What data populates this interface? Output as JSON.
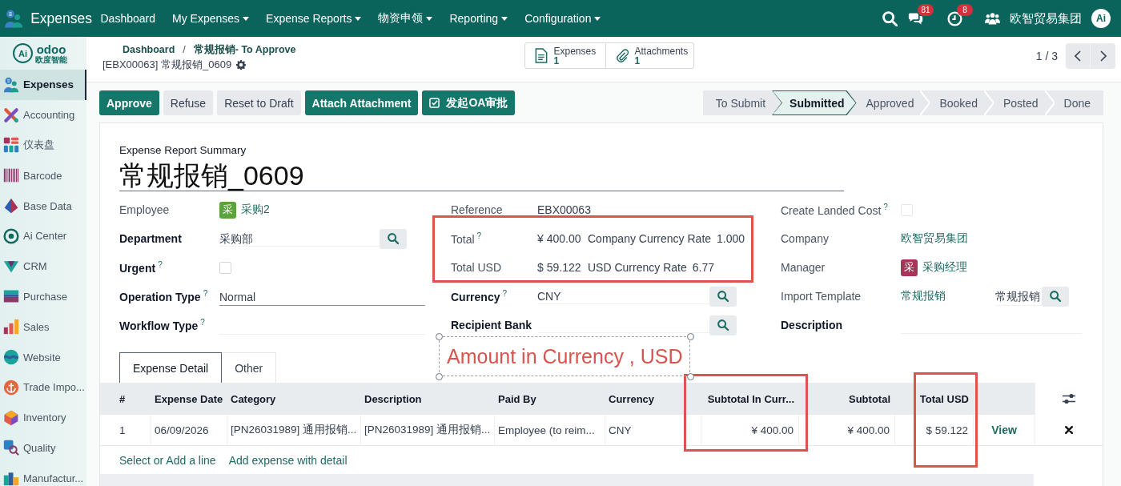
{
  "navbar": {
    "app_name": "Expenses",
    "menus": [
      {
        "label": "Dashboard",
        "dropdown": false
      },
      {
        "label": "My Expenses",
        "dropdown": true
      },
      {
        "label": "Expense Reports",
        "dropdown": true
      },
      {
        "label": "物资申领",
        "dropdown": true
      },
      {
        "label": "Reporting",
        "dropdown": true
      },
      {
        "label": "Configuration",
        "dropdown": true
      }
    ],
    "message_count": "81",
    "activity_count": "8",
    "company": "欧智贸易集团",
    "user_avatar": "Ai"
  },
  "sidebar": {
    "brand": {
      "mark": "Ai",
      "name": "odoo",
      "subtitle": "欧度智能"
    },
    "items": [
      {
        "label": "Expenses",
        "selected": true
      },
      {
        "label": "Accounting",
        "selected": false
      },
      {
        "label": "仪表盘",
        "selected": false
      },
      {
        "label": "Barcode",
        "selected": false
      },
      {
        "label": "Base Data",
        "selected": false
      },
      {
        "label": "Ai Center",
        "selected": false
      },
      {
        "label": "CRM",
        "selected": false
      },
      {
        "label": "Purchase",
        "selected": false
      },
      {
        "label": "Sales",
        "selected": false
      },
      {
        "label": "Website",
        "selected": false
      },
      {
        "label": "Trade Impo...",
        "selected": false
      },
      {
        "label": "Inventory",
        "selected": false
      },
      {
        "label": "Quality",
        "selected": false
      },
      {
        "label": "Manufactur...",
        "selected": false
      }
    ]
  },
  "control_panel": {
    "breadcrumbs": [
      "Dashboard",
      "常规报销- To Approve"
    ],
    "breadcrumb_separator": "/",
    "record_title": "[EBX00063] 常规报销_0609",
    "smart_buttons": [
      {
        "label": "Expenses",
        "count": "1"
      },
      {
        "label": "Attachments",
        "count": "1"
      }
    ],
    "pager": "1 / 3"
  },
  "actions": [
    {
      "label": "Approve",
      "kind": "primary",
      "checkbox_icon": false
    },
    {
      "label": "Refuse",
      "kind": "secondary",
      "checkbox_icon": false
    },
    {
      "label": "Reset to Draft",
      "kind": "secondary",
      "checkbox_icon": false
    },
    {
      "label": "Attach Attachment",
      "kind": "primary",
      "checkbox_icon": false
    },
    {
      "label": "发起OA审批",
      "kind": "primary",
      "checkbox_icon": true
    }
  ],
  "status_stages": [
    {
      "label": "To Submit",
      "selected": false
    },
    {
      "label": "Submitted",
      "selected": true
    },
    {
      "label": "Approved",
      "selected": false
    },
    {
      "label": "Booked",
      "selected": false
    },
    {
      "label": "Posted",
      "selected": false
    },
    {
      "label": "Done",
      "selected": false
    }
  ],
  "form": {
    "title_label": "Expense Report Summary",
    "title": "常规报销_0609",
    "columns": [
      {
        "fields": [
          {
            "label": "Employee",
            "readonly": true,
            "kind": "avatar",
            "avatar": {
              "letter": "采",
              "color": "#5ba33b"
            },
            "value": "采购2"
          },
          {
            "label": "Department",
            "readonly": false,
            "kind": "many2one",
            "value": "采购部"
          },
          {
            "label": "Urgent",
            "help": "?",
            "readonly": false,
            "kind": "checkbox",
            "checked": false
          },
          {
            "label": "Operation Type",
            "help": "?",
            "readonly": false,
            "kind": "select",
            "value": "Normal"
          },
          {
            "label": "Workflow Type",
            "help": "?",
            "readonly": false,
            "kind": "select"
          }
        ]
      },
      {
        "fields": [
          {
            "label": "Reference",
            "readonly": true,
            "kind": "text",
            "value": "EBX00063"
          },
          {
            "label": "Total",
            "help": "?",
            "readonly": true,
            "kind": "amount_rate",
            "value": "¥ 400.00",
            "rate_label": "Company Currency Rate",
            "rate": "1.000"
          },
          {
            "label": "Total USD",
            "readonly": true,
            "kind": "amount_rate",
            "value": "$ 59.122",
            "rate_label": "USD Currency Rate",
            "rate": "6.77"
          },
          {
            "label": "Currency",
            "help": "?",
            "readonly": false,
            "kind": "many2one",
            "value": "CNY"
          },
          {
            "label": "Recipient Bank",
            "readonly": false,
            "kind": "many2one"
          }
        ]
      },
      {
        "fields": [
          {
            "label": "Create Landed Cost",
            "help": "?",
            "readonly": true,
            "kind": "checkbox",
            "checked": false
          },
          {
            "label": "Company",
            "readonly": true,
            "kind": "link",
            "value": "欧智贸易集团"
          },
          {
            "label": "Manager",
            "readonly": true,
            "kind": "avatar",
            "avatar": {
              "letter": "采",
              "color": "#a83458"
            },
            "value": "采购经理"
          },
          {
            "label": "Import Template",
            "readonly": true,
            "kind": "template",
            "value": "常规报销",
            "input_value": "常规报销"
          },
          {
            "label": "Description",
            "readonly": false,
            "kind": "html"
          }
        ]
      }
    ]
  },
  "annotation": {
    "label": "Amount in Currency , USD"
  },
  "tabs": [
    {
      "label": "Expense Detail",
      "selected": true
    },
    {
      "label": "Other",
      "selected": false
    }
  ],
  "table": {
    "columns": [
      "#",
      "Expense Date",
      "Category",
      "Description",
      "Paid By",
      "Currency",
      "Subtotal In Curr...",
      "Subtotal",
      "Total USD"
    ],
    "rows": [
      {
        "cells": [
          "1",
          "06/09/2026",
          "[PN26031989] 通用报销...",
          "[PN26031989] 通用报销...",
          "Employee (to reim...",
          "CNY",
          "¥ 400.00",
          "¥ 400.00",
          "$ 59.122"
        ],
        "action": "View"
      }
    ],
    "footer_links": [
      "Select or Add a line",
      "Add expense with detail"
    ]
  }
}
